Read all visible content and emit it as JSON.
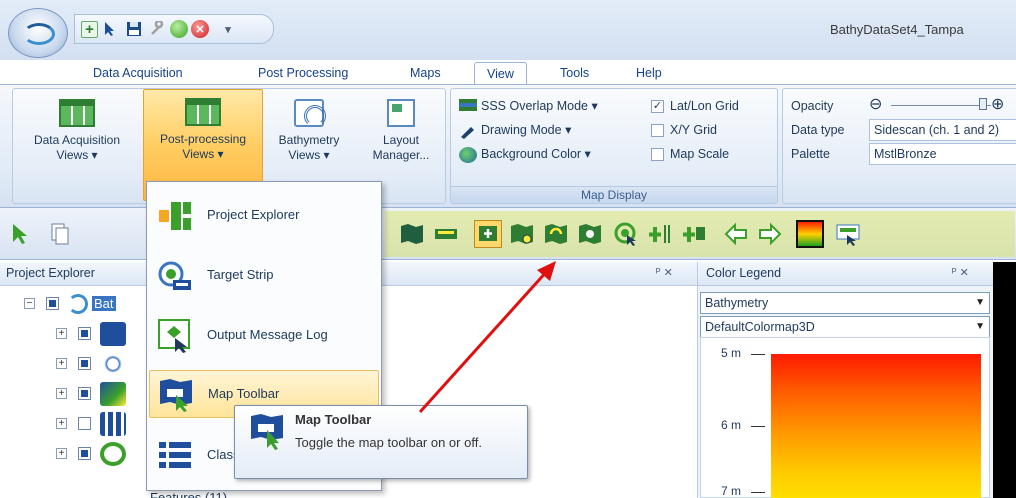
{
  "window": {
    "title": "BathyDataSet4_Tampa"
  },
  "quick_access": {
    "plus_glyph": "+",
    "stop_glyph": "✕",
    "dropdown_glyph": "▾"
  },
  "tabs": [
    "Data Acquisition",
    "Post Processing",
    "Maps",
    "View",
    "Tools",
    "Help"
  ],
  "ribbon": {
    "views_group": {
      "data_acquisition_line1": "Data Acquisition",
      "data_acquisition_line2": "Views ▾",
      "post_processing_line1": "Post-processing",
      "post_processing_line2": "Views ▾",
      "bathymetry_line1": "Bathymetry",
      "bathymetry_line2": "Views ▾",
      "layout_line1": "Layout",
      "layout_line2": "Manager..."
    },
    "map_display": {
      "caption": "Map Display",
      "sss_overlap_mode": "SSS Overlap Mode ▾",
      "drawing_mode": "Drawing Mode ▾",
      "background_color": "Background Color ▾",
      "lat_lon_grid": "Lat/Lon Grid",
      "lat_lon_grid_check": "✓",
      "xy_grid": "X/Y Grid",
      "map_scale": "Map Scale"
    },
    "properties": {
      "opacity_label": "Opacity",
      "data_type_label": "Data type",
      "palette_label": "Palette",
      "data_type_value": "Sidescan (ch. 1 and 2)",
      "palette_value": "MstlBronze",
      "slider_minus": "⊖",
      "slider_plus": "⊕"
    }
  },
  "panels": {
    "project_explorer_title": "Project Explorer",
    "pin_glyph": "ᴾ ✕",
    "root_label": "Bat",
    "features_label": "Features (11)",
    "color_legend_title": "Color Legend",
    "legend_pin_glyph": "ᴾ ✕",
    "legend_type": "Bathymetry",
    "legend_colormap": "DefaultColormap3D",
    "combo_arrow": "▼",
    "depths": [
      "5 m",
      "6 m",
      "7 m"
    ]
  },
  "menu": {
    "items": [
      "Project Explorer",
      "Target Strip",
      "Output Message Log",
      "Map Toolbar",
      "Class"
    ]
  },
  "tooltip": {
    "title": "Map Toolbar",
    "body": "Toggle the map toolbar on or off."
  },
  "colors": {
    "highlight": "#d6e256",
    "arrow": "#e01010",
    "active_button": "#ffcd62"
  }
}
